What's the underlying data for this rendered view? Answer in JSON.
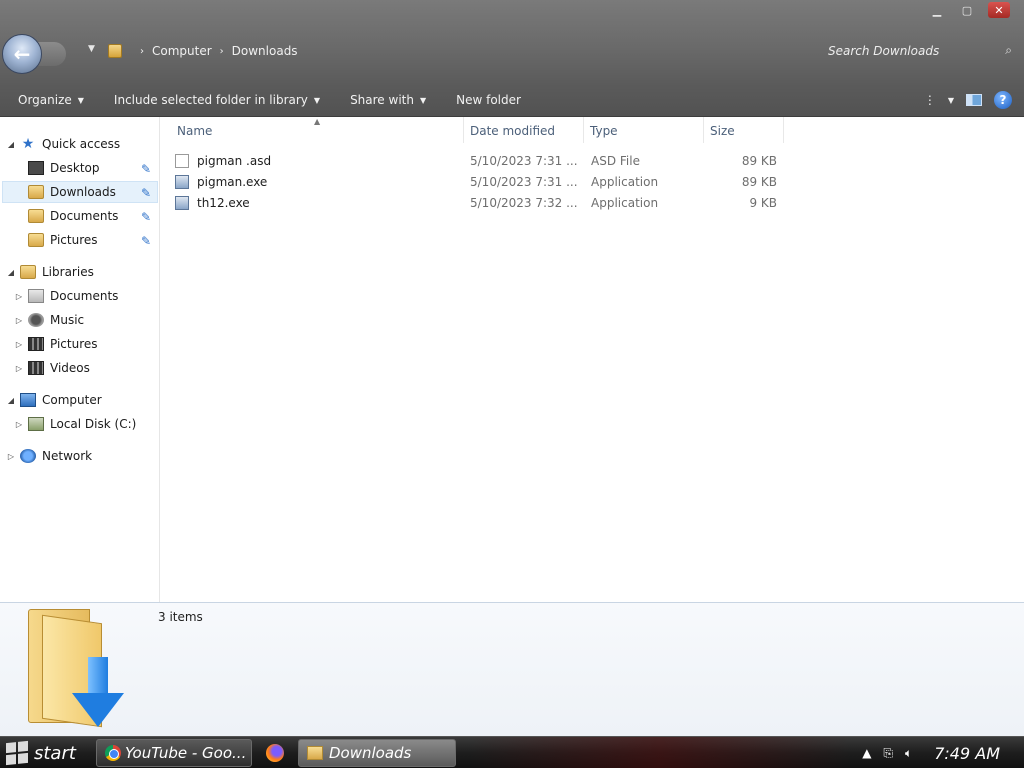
{
  "window": {
    "minimize_icon": "minimize-icon",
    "maximize_icon": "maximize-icon",
    "close_icon": "close-icon"
  },
  "nav_buttons": {
    "back_icon": "back-arrow-icon",
    "forward_icon": "forward-arrow-icon",
    "recent_icon": "chevron-down-icon"
  },
  "breadcrumb": {
    "items": [
      "Computer",
      "Downloads"
    ]
  },
  "search": {
    "placeholder": "Search Downloads",
    "icon": "search-icon"
  },
  "toolbar": {
    "organize": "Organize",
    "include": "Include selected folder in library",
    "share": "Share with",
    "new_folder": "New folder"
  },
  "sidebar": {
    "quick_access": "Quick access",
    "quick_items": [
      "Desktop",
      "Downloads",
      "Documents",
      "Pictures"
    ],
    "libraries": "Libraries",
    "library_items": [
      "Documents",
      "Music",
      "Pictures",
      "Videos"
    ],
    "computer": "Computer",
    "computer_items": [
      "Local Disk (C:)"
    ],
    "network": "Network"
  },
  "columns": {
    "name": "Name",
    "date": "Date modified",
    "type": "Type",
    "size": "Size"
  },
  "files": [
    {
      "name": "pigman .asd",
      "date": "5/10/2023 7:31 ...",
      "type": "ASD File",
      "size": "89 KB",
      "icon": "document-icon"
    },
    {
      "name": "pigman.exe",
      "date": "5/10/2023 7:31 ...",
      "type": "Application",
      "size": "89 KB",
      "icon": "application-icon"
    },
    {
      "name": "th12.exe",
      "date": "5/10/2023 7:32 ...",
      "type": "Application",
      "size": "9 KB",
      "icon": "application-icon"
    }
  ],
  "details": {
    "items_count": "3 items"
  },
  "taskbar": {
    "start": "start",
    "tasks": [
      "YouTube - Goo...",
      "Downloads"
    ],
    "clock": "7:49 AM"
  }
}
